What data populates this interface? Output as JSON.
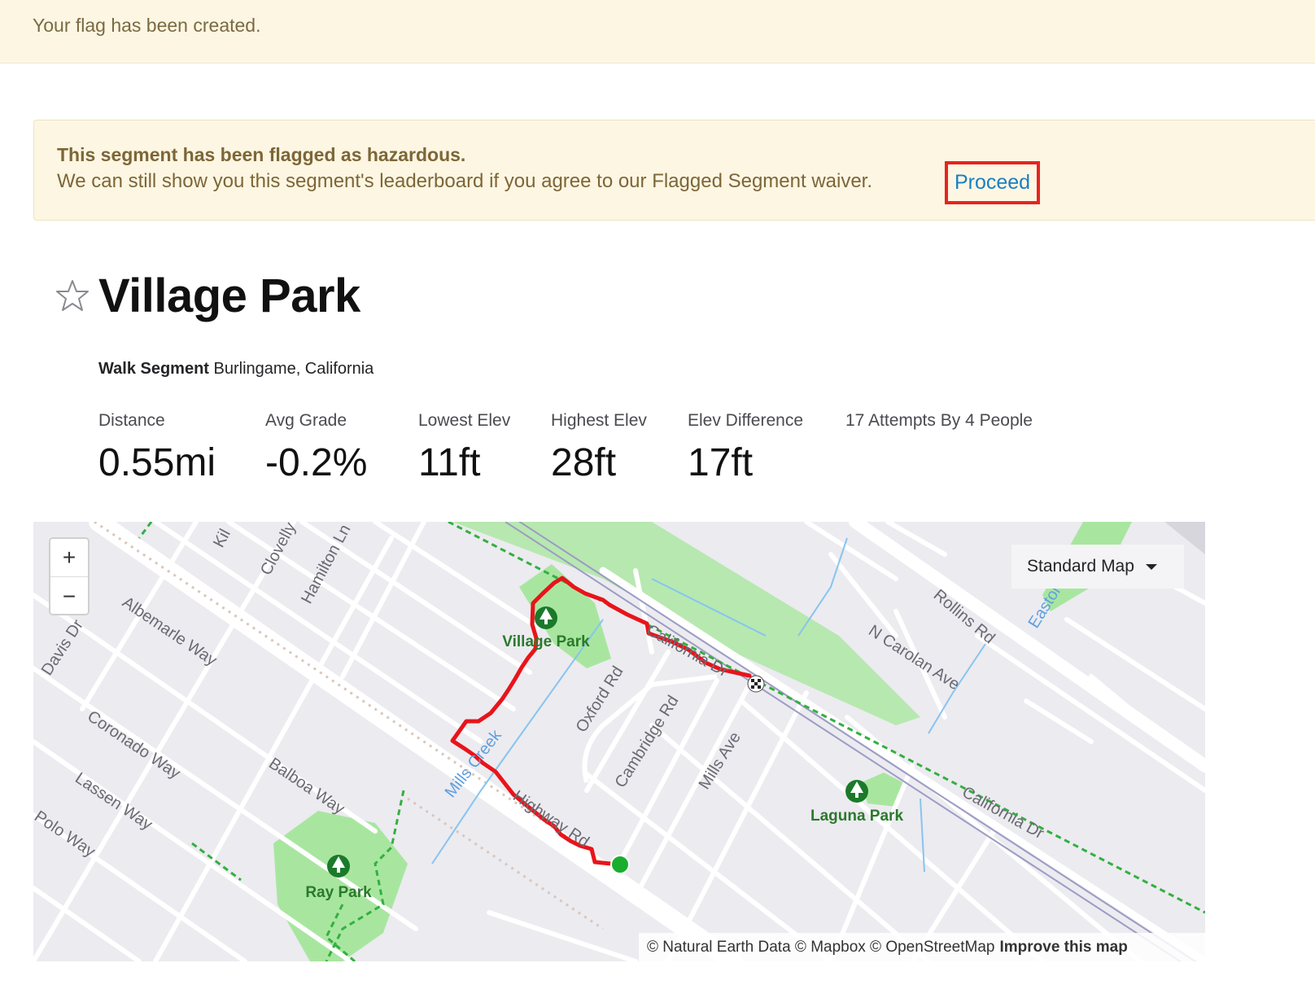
{
  "banner": {
    "message": "Your flag has been created."
  },
  "hazard": {
    "title": "This segment has been flagged as hazardous.",
    "text": "We can still show you this segment's leaderboard if you agree to our Flagged Segment waiver.",
    "proceed_label": "Proceed",
    "highlight_color": "#e8231f"
  },
  "segment": {
    "title": "Village Park",
    "type_label": "Walk Segment",
    "location": "Burlingame, California"
  },
  "stats": [
    {
      "label": "Distance",
      "value": "0.55mi"
    },
    {
      "label": "Avg Grade",
      "value": "-0.2%"
    },
    {
      "label": "Lowest Elev",
      "value": "11ft"
    },
    {
      "label": "Highest Elev",
      "value": "28ft"
    },
    {
      "label": "Elev Difference",
      "value": "17ft"
    },
    {
      "label": "17 Attempts By 4 People",
      "value": ""
    }
  ],
  "map": {
    "zoom_in": "+",
    "zoom_out": "−",
    "map_type": "Standard Map",
    "attribution": "© Natural Earth Data © Mapbox © OpenStreetMap",
    "improve": "Improve this map",
    "route_color": "#e8141a",
    "start_color": "#1aae2e",
    "streets": {
      "kil": "Kil",
      "clovelly": "Clovelly",
      "hamilton": "Hamilton Ln",
      "albemarle": "Albemarle Way",
      "davis": "Davis Dr",
      "coronado": "Coronado Way",
      "lassen": "Lassen Way",
      "polo": "Polo Way",
      "balboa": "Balboa Way",
      "oxford": "Oxford Rd",
      "cambridge": "Cambridge Rd",
      "mills_ave": "Mills Ave",
      "california_1": "California Dr",
      "california_2": "California Dr",
      "rollins": "Rollins Rd",
      "carolan": "N Carolan Ave",
      "easton": "Easton",
      "highway": "Highway Rd",
      "mills_creek": "Mills Creek"
    },
    "parks": {
      "village": "Village Park",
      "laguna": "Laguna Park",
      "ray": "Ray Park"
    }
  }
}
